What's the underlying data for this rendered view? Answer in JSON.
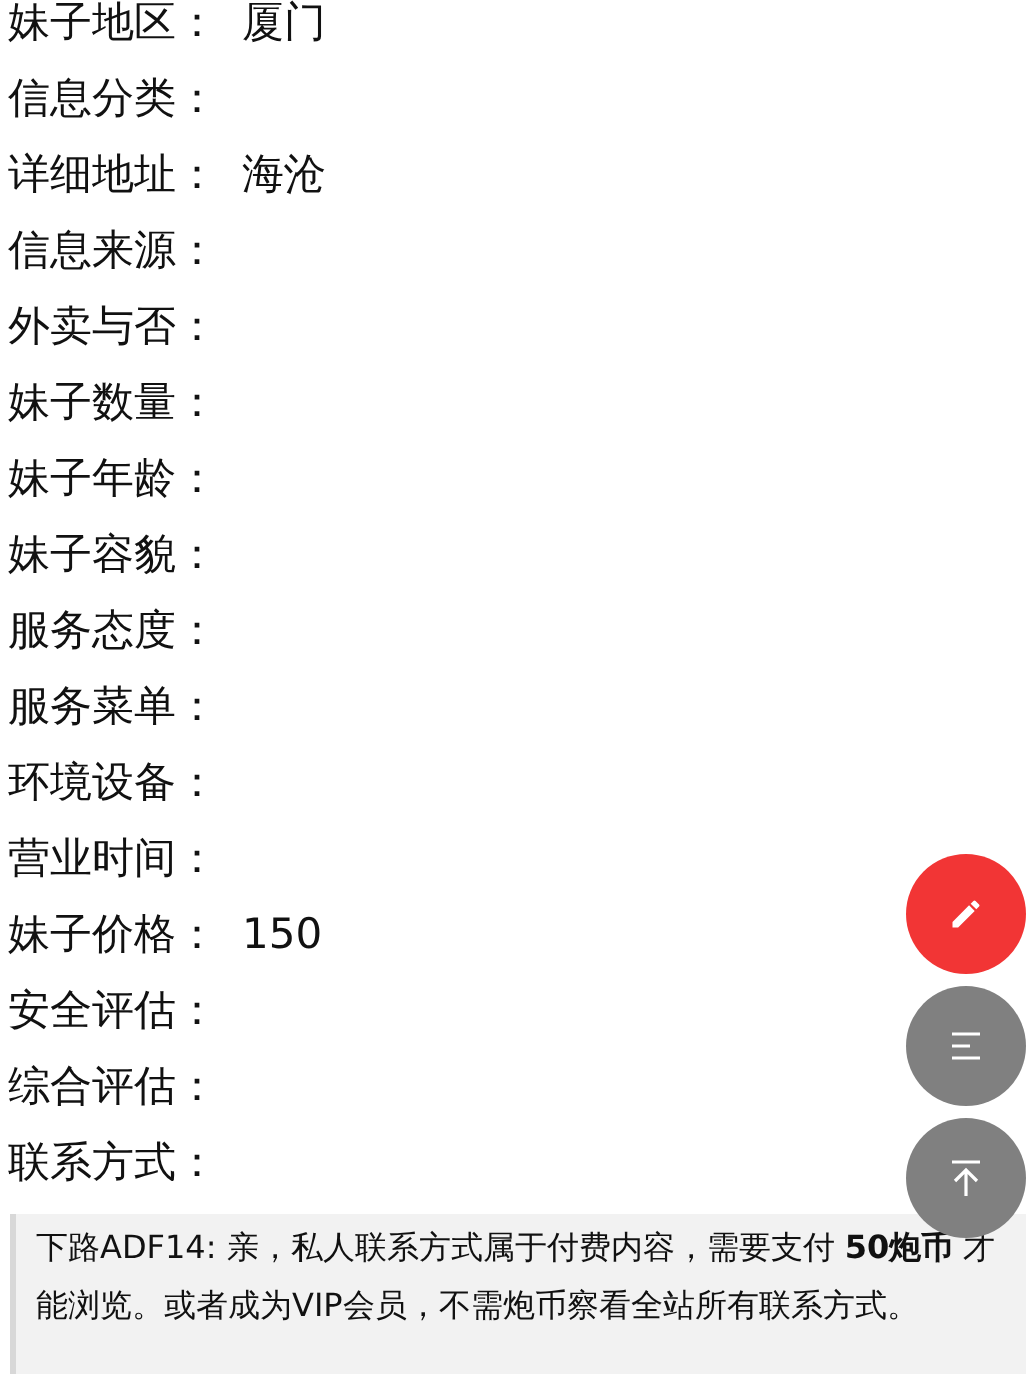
{
  "fields": [
    {
      "label": "妹子地区：",
      "value": "厦门"
    },
    {
      "label": "信息分类："
    },
    {
      "label": "详细地址：",
      "value": "海沧"
    },
    {
      "label": "信息来源："
    },
    {
      "label": "外卖与否："
    },
    {
      "label": "妹子数量："
    },
    {
      "label": "妹子年龄："
    },
    {
      "label": "妹子容貌："
    },
    {
      "label": "服务态度："
    },
    {
      "label": "服务菜单："
    },
    {
      "label": "环境设备："
    },
    {
      "label": "营业时间："
    },
    {
      "label": "妹子价格：",
      "value": "150"
    },
    {
      "label": "安全评估："
    },
    {
      "label": "综合评估："
    },
    {
      "label": "联系方式："
    }
  ],
  "notice": "下路ADF14: 亲，私人联系方式属于付费内容，需要支付 **50炮币** 才能浏览。或者成为VIP会员，不需炮币察看全站所有联系方式。",
  "fab_buttons": [
    {
      "kind": "edit"
    },
    {
      "kind": "menu"
    },
    {
      "kind": "top"
    }
  ]
}
